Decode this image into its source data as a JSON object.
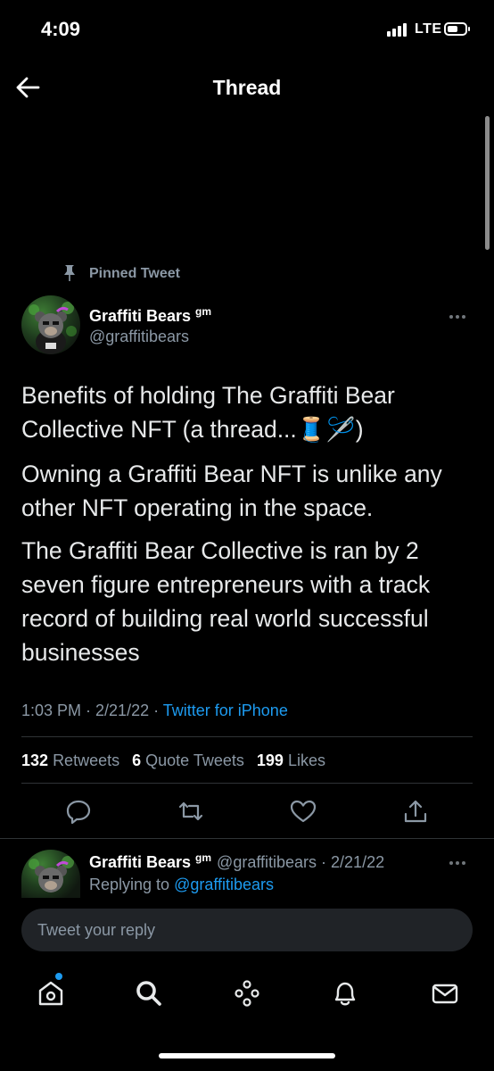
{
  "status_bar": {
    "time": "4:09",
    "network": "LTE"
  },
  "header": {
    "title": "Thread",
    "back_icon": "arrow-left-icon"
  },
  "tweet": {
    "pinned_label": "Pinned Tweet",
    "author_name": "Graffiti Bears",
    "author_badge": "gm",
    "author_handle": "@graffitibears",
    "paragraphs": [
      "Benefits of holding The Graffiti Bear Collective NFT (a thread...🧵🪡)",
      "Owning a Graffiti Bear NFT is unlike any other NFT operating in the space.",
      "The Graffiti Bear Collective is ran by 2 seven figure entrepreneurs with a track record of building real world successful businesses"
    ],
    "timestamp": "1:03 PM · 2/21/22 · ",
    "source": "Twitter for iPhone",
    "retweets_count": "132",
    "retweets_label": "Retweets",
    "quote_count": "6",
    "quote_label": "Quote Tweets",
    "likes_count": "199",
    "likes_label": "Likes"
  },
  "reply": {
    "author_name": "Graffiti Bears",
    "author_badge": "gm",
    "handle_date": "@graffitibears · 2/21/22",
    "replying_prefix": "Replying to ",
    "replying_to": "@graffitibears"
  },
  "composer": {
    "placeholder": "Tweet your reply"
  },
  "colors": {
    "accent": "#1d9bf0",
    "background": "#000000",
    "muted": "#8b98a5"
  },
  "nav_icons": [
    "home-icon",
    "search-icon",
    "spaces-icon",
    "notifications-icon",
    "messages-icon"
  ]
}
